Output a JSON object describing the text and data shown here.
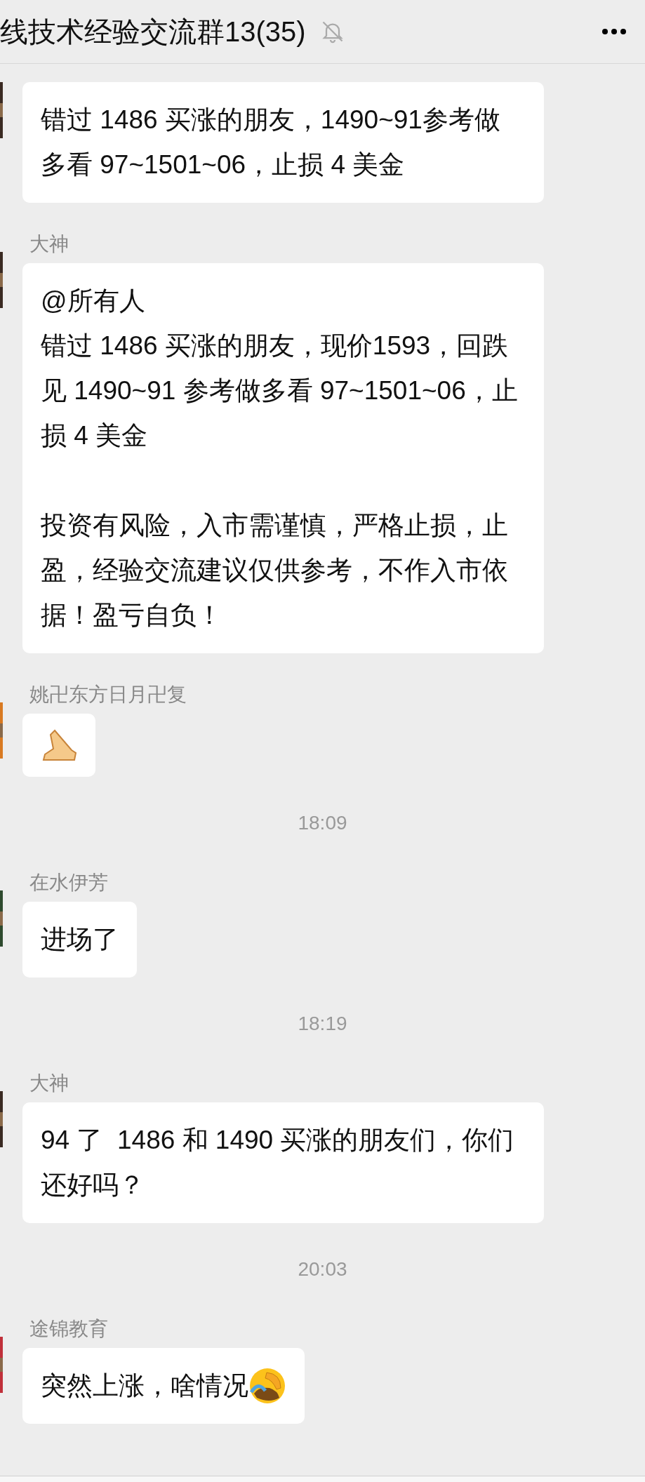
{
  "header": {
    "title": "线技术经验交流群13(35)",
    "muted": true
  },
  "items": [
    {
      "kind": "text",
      "paragraphs": [
        "错过 1486 买涨的朋友，1490~91参考做多看 97~1501~06，止损 4 美金"
      ]
    },
    {
      "kind": "text",
      "sender": "大神",
      "paragraphs": [
        "@所有人",
        "错过 1486 买涨的朋友，现价1593，回跌见 1490~91 参考做多看 97~1501~06，止损 4 美金"
      ],
      "footer": "投资有风险，入市需谨慎，严格止损，止盈，经验交流建议仅供参考，不作入市依据！盈亏自负！"
    },
    {
      "kind": "sticker",
      "sender": "姚卍东方日月卍复"
    },
    {
      "kind": "time",
      "text": "18:09"
    },
    {
      "kind": "text",
      "sender": "在水伊芳",
      "paragraphs": [
        "进场了"
      ]
    },
    {
      "kind": "time",
      "text": "18:19"
    },
    {
      "kind": "text",
      "sender": "大神",
      "paragraphs": [
        "94 了  1486 和 1490 买涨的朋友们，你们还好吗？"
      ]
    },
    {
      "kind": "time",
      "text": "20:03"
    },
    {
      "kind": "text_emoji",
      "sender": "途锦教育",
      "paragraphs": [
        "突然上涨，啥情况"
      ]
    }
  ]
}
